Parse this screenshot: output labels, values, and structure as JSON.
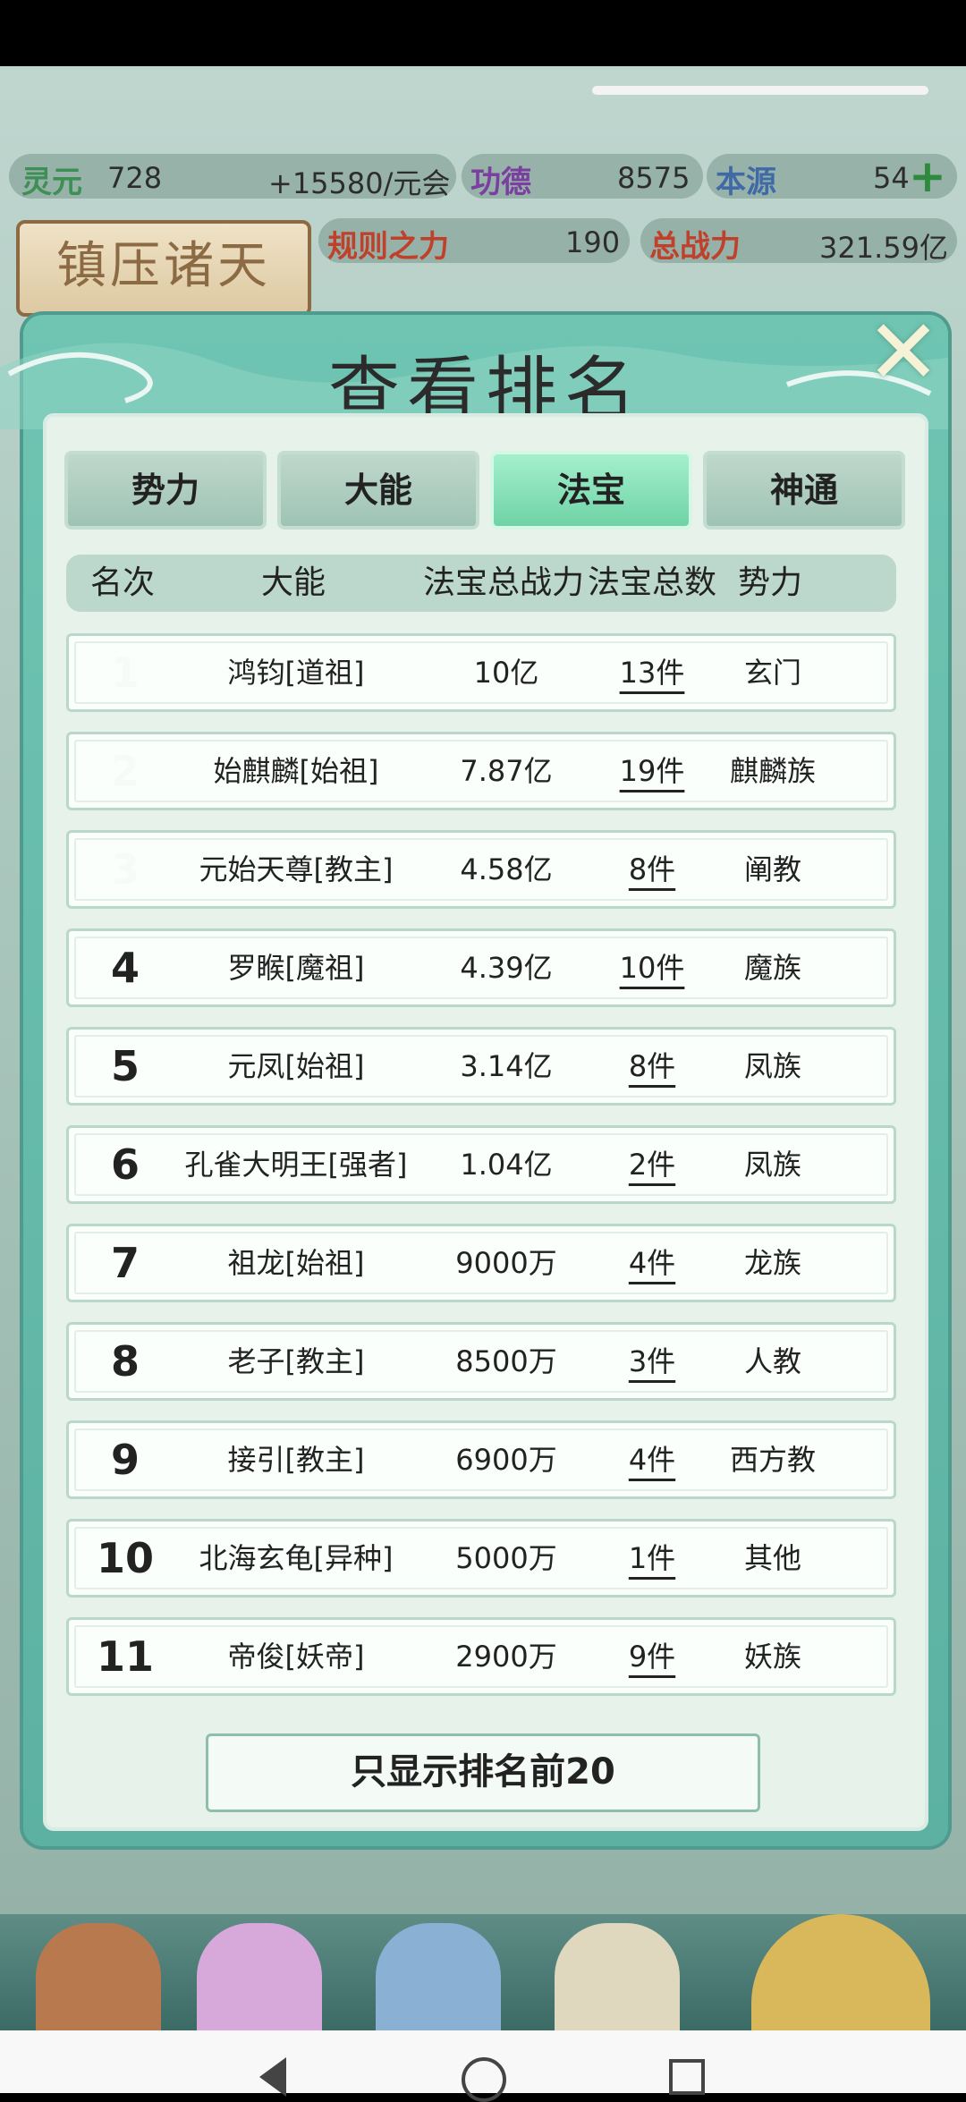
{
  "resources": {
    "lingyuan_label": "灵元",
    "lingyuan_value": "728",
    "rate": "+15580/元会",
    "gongde_label": "功德",
    "gongde_value": "8575",
    "benyuan_label": "本源",
    "benyuan_value": "54",
    "guize_label": "规则之力",
    "guize_value": "190",
    "zongzhanli_label": "总战力",
    "zongzhanli_value": "321.59亿",
    "zhenya_label": "镇压诸天"
  },
  "modal": {
    "title": "查看排名",
    "close_glyph": "✕",
    "tabs": [
      {
        "label": "势力",
        "active": false
      },
      {
        "label": "大能",
        "active": false
      },
      {
        "label": "法宝",
        "active": true
      },
      {
        "label": "神通",
        "active": false
      }
    ],
    "columns": [
      "名次",
      "大能",
      "法宝总战力",
      "法宝总数",
      "势力"
    ],
    "rows": [
      {
        "rank": "1",
        "name": "鸿钧[道祖]",
        "power": "10亿",
        "count": "13件",
        "faction": "玄门"
      },
      {
        "rank": "2",
        "name": "始麒麟[始祖]",
        "power": "7.87亿",
        "count": "19件",
        "faction": "麒麟族"
      },
      {
        "rank": "3",
        "name": "元始天尊[教主]",
        "power": "4.58亿",
        "count": "8件",
        "faction": "阐教"
      },
      {
        "rank": "4",
        "name": "罗睺[魔祖]",
        "power": "4.39亿",
        "count": "10件",
        "faction": "魔族"
      },
      {
        "rank": "5",
        "name": "元凤[始祖]",
        "power": "3.14亿",
        "count": "8件",
        "faction": "凤族"
      },
      {
        "rank": "6",
        "name": "孔雀大明王[强者]",
        "power": "1.04亿",
        "count": "2件",
        "faction": "凤族"
      },
      {
        "rank": "7",
        "name": "祖龙[始祖]",
        "power": "9000万",
        "count": "4件",
        "faction": "龙族"
      },
      {
        "rank": "8",
        "name": "老子[教主]",
        "power": "8500万",
        "count": "3件",
        "faction": "人教"
      },
      {
        "rank": "9",
        "name": "接引[教主]",
        "power": "6900万",
        "count": "4件",
        "faction": "西方教"
      },
      {
        "rank": "10",
        "name": "北海玄龟[异种]",
        "power": "5000万",
        "count": "1件",
        "faction": "其他"
      },
      {
        "rank": "11",
        "name": "帝俊[妖帝]",
        "power": "2900万",
        "count": "9件",
        "faction": "妖族"
      }
    ],
    "show_top_button": "只显示排名前20"
  }
}
